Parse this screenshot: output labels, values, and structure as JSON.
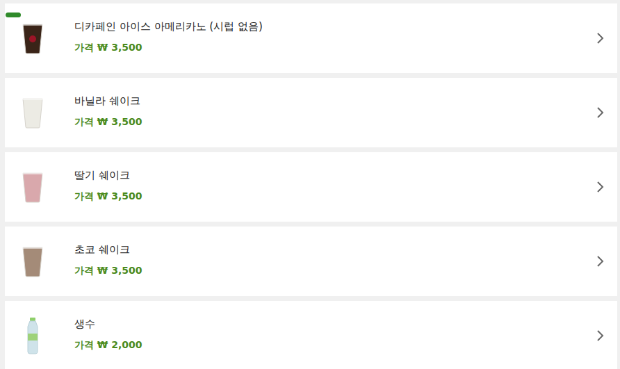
{
  "menu": {
    "items": [
      {
        "name": "디카페인 아이스 아메리카노 (시럽 없음)",
        "price": "가격 ₩ 3,500",
        "kind": "cup",
        "color": "#3a2418",
        "badge": true
      },
      {
        "name": "바닐라 쉐이크",
        "price": "가격 ₩ 3,500",
        "kind": "cup",
        "color": "#ecebe4",
        "badge": false
      },
      {
        "name": "딸기 쉐이크",
        "price": "가격 ₩ 3,500",
        "kind": "cup",
        "color": "#d9a8ac",
        "badge": false
      },
      {
        "name": "초코 쉐이크",
        "price": "가격 ₩ 3,500",
        "kind": "cup",
        "color": "#a48b78",
        "badge": false
      },
      {
        "name": "생수",
        "price": "가격 ₩ 2,000",
        "kind": "bottle",
        "color": "#cfe3ea",
        "badge": false
      }
    ]
  }
}
